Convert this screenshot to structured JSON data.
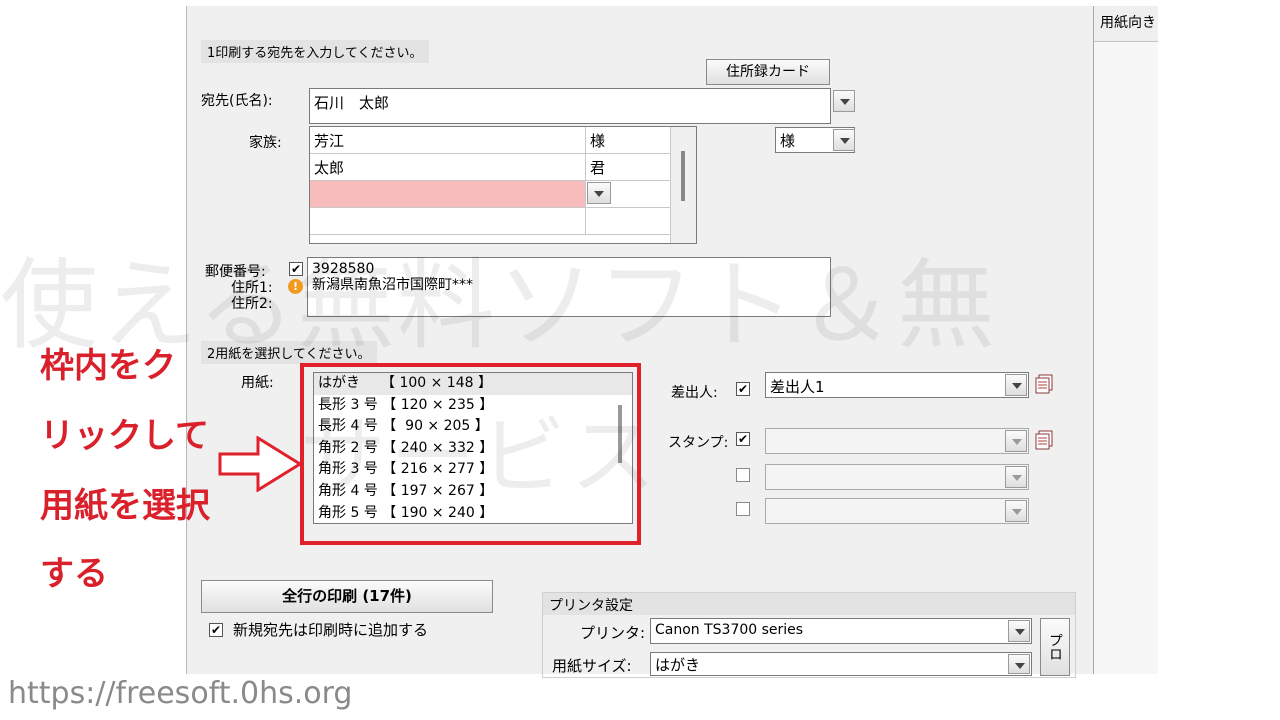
{
  "section1": {
    "title": "1印刷する宛先を入力してください。"
  },
  "address_book_button": "住所録カード",
  "recipient": {
    "label": "宛先(氏名):",
    "value": "石川　太郎"
  },
  "family": {
    "label": "家族:",
    "rows": [
      {
        "name": "芳江",
        "honorific": "様"
      },
      {
        "name": "太郎",
        "honorific": "君"
      },
      {
        "name": "",
        "honorific": ""
      },
      {
        "name": "",
        "honorific": ""
      }
    ],
    "honorific_select": "様"
  },
  "postal": {
    "postal_label": "郵便番号:",
    "address1_label": "住所1:",
    "address2_label": "住所2:",
    "postal_code": "3928580",
    "address1": "新潟県南魚沼市国際町***"
  },
  "section2": {
    "title": "2用紙を選択してください。"
  },
  "paper": {
    "label": "用紙:",
    "items": [
      "はがき　　【 100 × 148 】",
      "長形 3 号 【 120 × 235 】",
      "長形 4 号 【  90 × 205 】",
      "角形 2 号 【 240 × 332 】",
      "角形 3 号 【 216 × 277 】",
      "角形 4 号 【 197 × 267 】",
      "角形 5 号 【 190 × 240 】"
    ]
  },
  "sender": {
    "label": "差出人:",
    "value": "差出人1"
  },
  "stamp": {
    "label": "スタンプ:"
  },
  "print_all_button": "全行の印刷 (17件)",
  "add_new_checkbox": "新規宛先は印刷時に追加する",
  "printer_settings": {
    "title": "プリンタ設定",
    "printer_label": "プリンタ:",
    "printer_value": "Canon TS3700 series",
    "paper_size_label": "用紙サイズ:",
    "paper_size_value": "はがき",
    "side_button": "プロ"
  },
  "right_pane": {
    "title": "用紙向き"
  },
  "annotation": {
    "line1": "枠内をク",
    "line2": "リックして",
    "line3": "用紙を選択",
    "line4": "する"
  },
  "watermark": {
    "line1": "使える無料ソフト＆無",
    "line2": "サービス"
  },
  "footer_url": "https://freesoft.0hs.org"
}
